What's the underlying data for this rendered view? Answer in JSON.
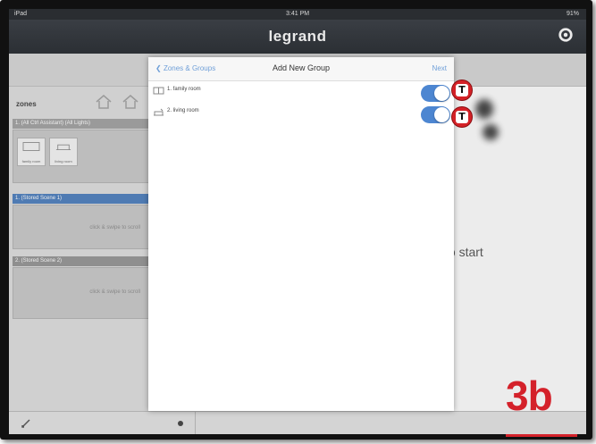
{
  "status_bar": {
    "carrier": "iPad",
    "time": "3:41 PM",
    "battery": "91%"
  },
  "app": {
    "logo": "legrand",
    "settings_icon": "gear-icon"
  },
  "left_panel": {
    "title": "zones",
    "scenes": [
      {
        "header": "1. (All Ctrl Assistant) (All Lights)",
        "hint": "",
        "tiles": [
          "family room",
          "living room"
        ]
      },
      {
        "header": "1. (Stored Scene 1)",
        "hint": "click & swipe to scroll"
      },
      {
        "header": "2. (Stored Scene 2)",
        "hint": "click & swipe to scroll"
      }
    ]
  },
  "modal": {
    "back_label": "Zones & Groups",
    "title": "Add New Group",
    "next_label": "Next",
    "rooms": [
      {
        "label": "1. family room",
        "icon": "sofa-icon",
        "toggle_on": true
      },
      {
        "label": "2. living room",
        "icon": "armchair-icon",
        "toggle_on": true
      }
    ]
  },
  "right_panel": {
    "hint_text": "to start"
  },
  "badge_letter": "T",
  "step_label": "3b",
  "colors": {
    "accent_blue": "#4d86d1",
    "badge_red": "#d42127",
    "header_dark": "#2b2f34"
  }
}
